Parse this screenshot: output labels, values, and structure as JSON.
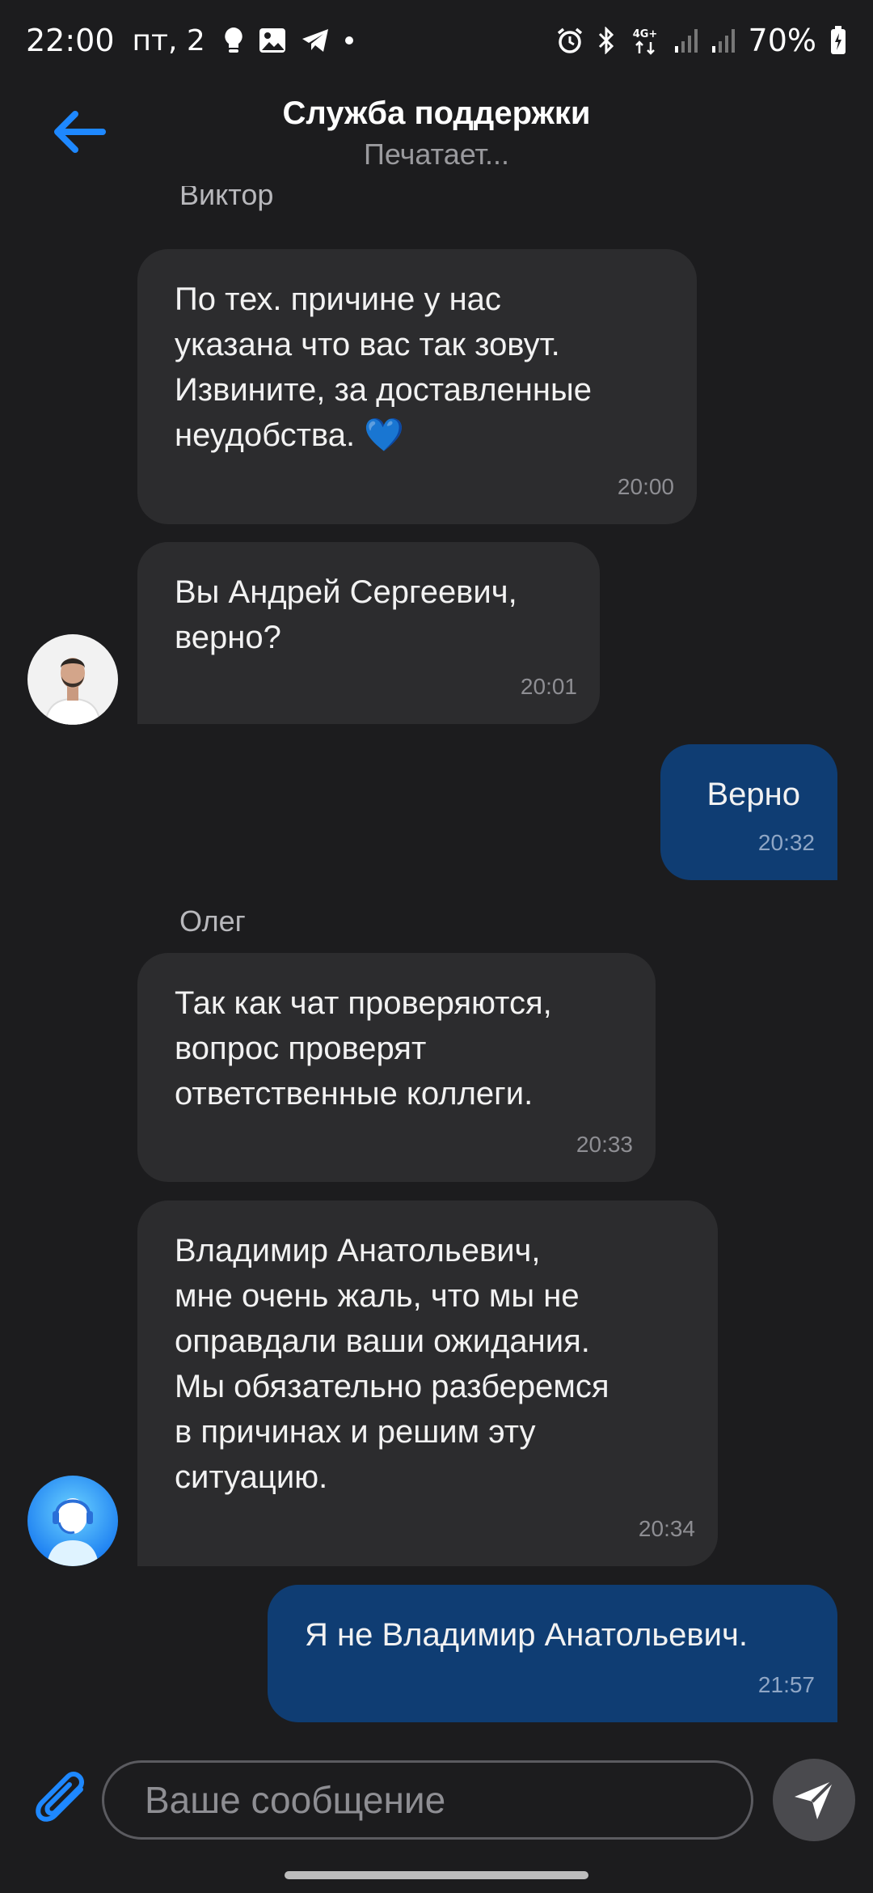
{
  "status_bar": {
    "time": "22:00",
    "date": "пт, 2",
    "network": "4G+",
    "battery": "70%"
  },
  "header": {
    "title": "Служба поддержки",
    "subtitle": "Печатает..."
  },
  "messages": [
    {
      "sender": "Виктор",
      "text": "По тех. причине у нас\nуказана что вас так зовут.\nИзвините, за доставленные\nнеудобства. 💙",
      "time": "20:00"
    },
    {
      "text": "Вы Андрей Сергеевич,\nверно?",
      "time": "20:01"
    },
    {
      "text": "Верно",
      "time": "20:32"
    },
    {
      "sender": "Олег",
      "text": "Так как чат проверяются,\nвопрос проверят\nответственные коллеги.",
      "time": "20:33"
    },
    {
      "text": "Владимир Анатольевич,\nмне очень жаль, что мы не\nоправдали ваши ожидания.\nМы обязательно разберемся\nв причинах и решим эту\nситуацию.",
      "time": "20:34"
    },
    {
      "text": "Я не Владимир Анатольевич.",
      "time": "21:57"
    }
  ],
  "composer": {
    "placeholder": "Ваше сообщение"
  },
  "colors": {
    "background": "#1c1c1e",
    "incoming_bubble": "#2c2c2e",
    "outgoing_bubble": "#0f3d73",
    "accent": "#1e88ff"
  }
}
